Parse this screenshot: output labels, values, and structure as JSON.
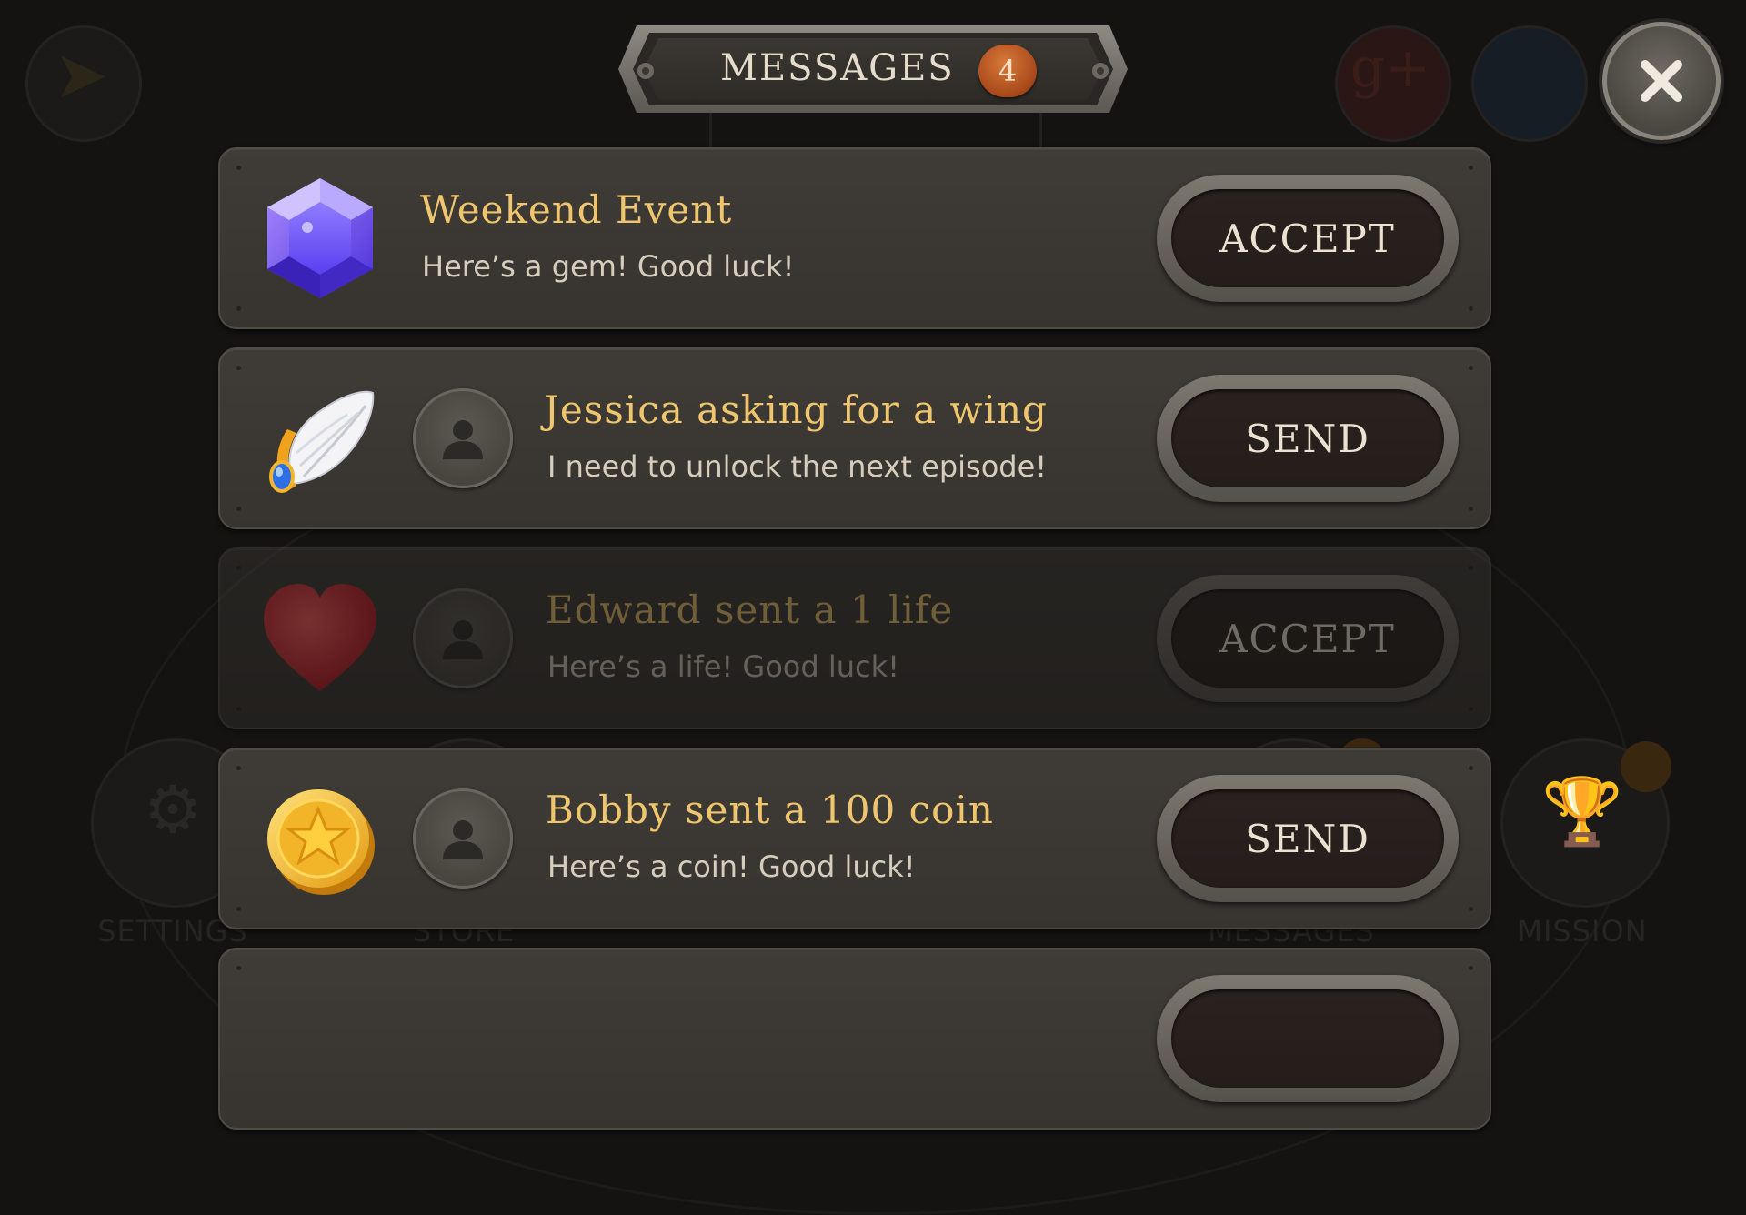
{
  "header": {
    "title": "MESSAGES",
    "count": "4"
  },
  "background_menu": {
    "items": [
      "SETTINGS",
      "STORE",
      "MESSAGES",
      "MISSION"
    ]
  },
  "messages": [
    {
      "title": "Weekend Event",
      "subtitle": "Here’s a gem! Good luck!",
      "action": "ACCEPT",
      "item_icon": "gem-icon",
      "has_avatar": false,
      "dimmed": false
    },
    {
      "title": "Jessica asking for a wing",
      "subtitle": "I need to unlock the next episode!",
      "action": "SEND",
      "item_icon": "wing-icon",
      "has_avatar": true,
      "dimmed": false
    },
    {
      "title": "Edward sent a 1 life",
      "subtitle": "Here’s a life! Good luck!",
      "action": "ACCEPT",
      "item_icon": "heart-icon",
      "has_avatar": true,
      "dimmed": true
    },
    {
      "title": "Bobby sent a 100 coin",
      "subtitle": "Here’s a coin! Good luck!",
      "action": "SEND",
      "item_icon": "coin-icon",
      "has_avatar": true,
      "dimmed": false
    }
  ],
  "colors": {
    "title_gold": "#efc66e",
    "badge_orange": "#b8521f",
    "card_bg": "#3c3834",
    "button_inner": "#2a221f"
  }
}
